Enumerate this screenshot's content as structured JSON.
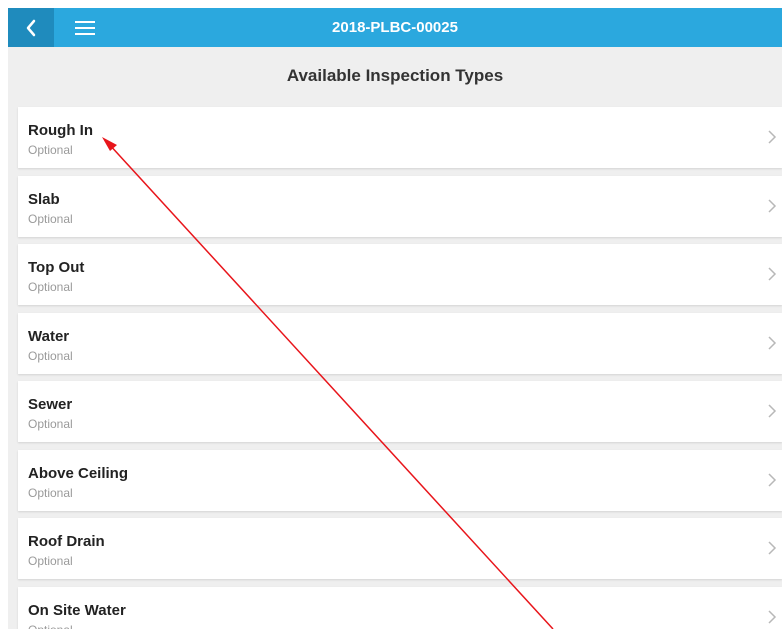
{
  "header": {
    "title": "2018-PLBC-00025",
    "colors": {
      "bar": "#2ba8de",
      "back_button": "#1f8bbd"
    },
    "back_icon": "chevron-left-icon",
    "menu_icon": "hamburger-menu-icon"
  },
  "section": {
    "title": "Available Inspection Types"
  },
  "inspections": [
    {
      "name": "Rough In",
      "status": "Optional"
    },
    {
      "name": "Slab",
      "status": "Optional"
    },
    {
      "name": "Top Out",
      "status": "Optional"
    },
    {
      "name": "Water",
      "status": "Optional"
    },
    {
      "name": "Sewer",
      "status": "Optional"
    },
    {
      "name": "Above Ceiling",
      "status": "Optional"
    },
    {
      "name": "Roof Drain",
      "status": "Optional"
    },
    {
      "name": "On Site Water",
      "status": "Optional"
    }
  ],
  "annotation": {
    "color": "#e8151b",
    "type": "arrow"
  }
}
